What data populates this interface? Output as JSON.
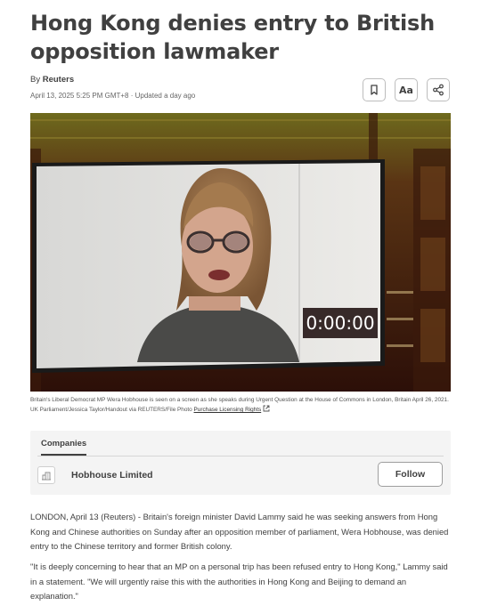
{
  "article": {
    "headline": "Hong Kong denies entry to British opposition lawmaker",
    "byline_prefix": "By",
    "byline_author": "Reuters",
    "dateline": "April 13, 2025 5:25 PM GMT+8 · Updated a day ago"
  },
  "toolbar": {
    "bookmark_icon": "bookmark-icon",
    "text_size_label": "Aa",
    "share_icon": "share-icon"
  },
  "photo": {
    "screen_timestamp": "0:00:00",
    "caption": "Britain's Liberal Democrat MP Wera Hobhouse is seen on a screen as she speaks during Urgent Question at the House of Commons in London, Britain April 26, 2021. UK Parliament/Jessica Taylor/Handout via REUTERS/File Photo",
    "license_link": "Purchase Licensing Rights",
    "external_icon": "external-link-icon"
  },
  "companies": {
    "tab_label": "Companies",
    "company_name": "Hobhouse Limited",
    "company_icon": "building-icon",
    "follow_label": "Follow"
  },
  "body": {
    "p1": "LONDON, April 13 (Reuters) - Britain's foreign minister David Lammy said he was seeking answers from Hong Kong and Chinese authorities on Sunday after an opposition member of parliament, Wera Hobhouse, was denied entry to the Chinese territory and former British colony.",
    "p2": "\"It is deeply concerning to hear that an MP on a personal trip has been refused entry to Hong Kong,\" Lammy said in a statement. \"We will urgently raise this with the authorities in Hong Kong and Beijing to demand an explanation.\""
  }
}
